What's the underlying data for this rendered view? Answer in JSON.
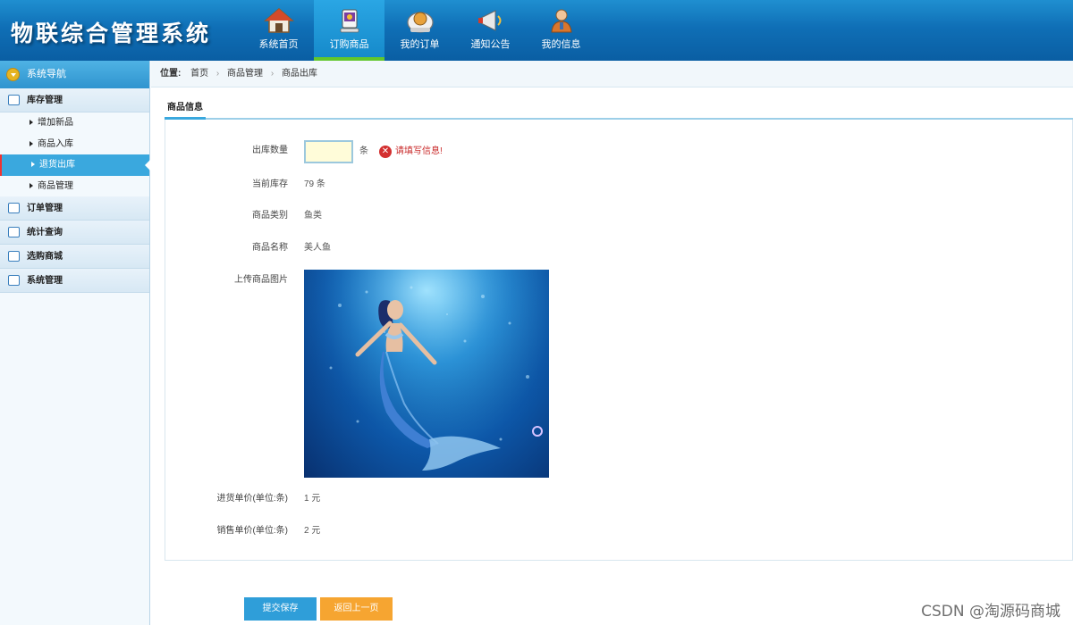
{
  "app": {
    "title": "物联综合管理系统"
  },
  "nav": [
    {
      "label": "系统首页",
      "icon": "house-icon"
    },
    {
      "label": "订购商品",
      "icon": "shopping-icon"
    },
    {
      "label": "我的订单",
      "icon": "order-icon"
    },
    {
      "label": "通知公告",
      "icon": "megaphone-icon"
    },
    {
      "label": "我的信息",
      "icon": "user-icon"
    }
  ],
  "sidebar": {
    "header": "系统导航",
    "groups": [
      {
        "label": "库存管理",
        "items": [
          "增加新品",
          "商品入库",
          "退货出库",
          "商品管理"
        ],
        "active_item": "退货出库"
      },
      {
        "label": "订单管理"
      },
      {
        "label": "统计查询"
      },
      {
        "label": "选购商城"
      },
      {
        "label": "系统管理"
      }
    ]
  },
  "breadcrumb": {
    "label": "位置:",
    "items": [
      "首页",
      "商品管理",
      "商品出库"
    ]
  },
  "tab": {
    "label": "商品信息"
  },
  "form": {
    "quantity": {
      "label": "出库数量",
      "value": "",
      "unit": "条",
      "error": "请填写信息!"
    },
    "stock": {
      "label": "当前库存",
      "value": "79  条"
    },
    "category": {
      "label": "商品类别",
      "value": "鱼类"
    },
    "name": {
      "label": "商品名称",
      "value": "美人鱼"
    },
    "image": {
      "label": "上传商品图片"
    },
    "purchase_price": {
      "label": "进货单价(单位:条)",
      "value": "1  元"
    },
    "sale_price": {
      "label": "销售单价(单位:条)",
      "value": "2  元"
    }
  },
  "buttons": {
    "submit": "提交保存",
    "back": "返回上一页"
  },
  "watermark": "CSDN @淘源码商城",
  "colors": {
    "header": "#0f6fb6",
    "active_nav": "#2aa6e4",
    "sidebar_active": "#3aa8de",
    "error": "#c92a2a",
    "submit": "#2f9ed9",
    "back": "#f6a531"
  }
}
